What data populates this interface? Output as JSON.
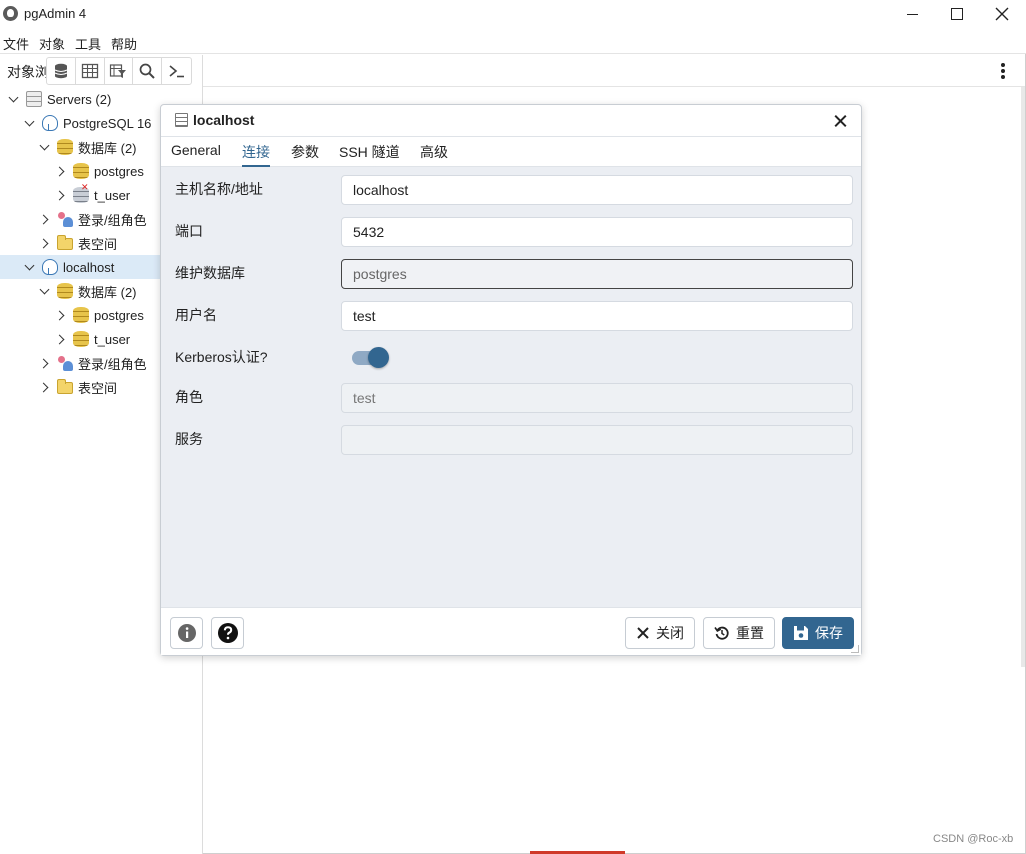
{
  "window": {
    "title": "pgAdmin 4"
  },
  "menu": [
    "文件",
    "对象",
    "工具",
    "帮助"
  ],
  "left_panel": {
    "tab_label": "对象浏",
    "toolbar_icons": [
      "database-icon",
      "table-icon",
      "filter-table-icon",
      "search-icon",
      "terminal-icon"
    ],
    "tree": [
      {
        "label": "Servers (2)",
        "icon": "servers-icon"
      },
      {
        "label": "PostgreSQL 16",
        "icon": "elephant-icon"
      },
      {
        "label": "数据库 (2)",
        "icon": "database-icon"
      },
      {
        "label": "postgres",
        "icon": "database-icon"
      },
      {
        "label": "t_user",
        "icon": "database-disconnected-icon"
      },
      {
        "label": "登录/组角色",
        "icon": "roles-icon"
      },
      {
        "label": "表空间",
        "icon": "folder-icon"
      },
      {
        "label": "localhost",
        "icon": "elephant-icon"
      },
      {
        "label": "数据库 (2)",
        "icon": "database-icon"
      },
      {
        "label": "postgres",
        "icon": "database-icon"
      },
      {
        "label": "t_user",
        "icon": "database-icon"
      },
      {
        "label": "登录/组角色",
        "icon": "roles-icon"
      },
      {
        "label": "表空间",
        "icon": "folder-icon"
      }
    ]
  },
  "dialog": {
    "title": "localhost",
    "tabs": [
      "General",
      "连接",
      "参数",
      "SSH 隧道",
      "高级"
    ],
    "active_tab": "连接",
    "fields": [
      {
        "label": "主机名称/地址",
        "value": "localhost"
      },
      {
        "label": "端口",
        "value": "5432"
      },
      {
        "label": "维护数据库",
        "value": "postgres"
      },
      {
        "label": "用户名",
        "value": "test"
      },
      {
        "label": "Kerberos认证?",
        "value": "on"
      },
      {
        "label": "角色",
        "value": "test"
      },
      {
        "label": "服务",
        "value": ""
      }
    ],
    "footer": {
      "info_icon": "info-icon",
      "help_icon": "help-icon",
      "close_label": "关闭",
      "reset_label": "重置",
      "save_label": "保存"
    }
  },
  "colors": {
    "accent": "#326690",
    "selection": "#dbeaf7",
    "dialog_body": "#ebeef3"
  },
  "watermark": "CSDN @Roc-xb"
}
